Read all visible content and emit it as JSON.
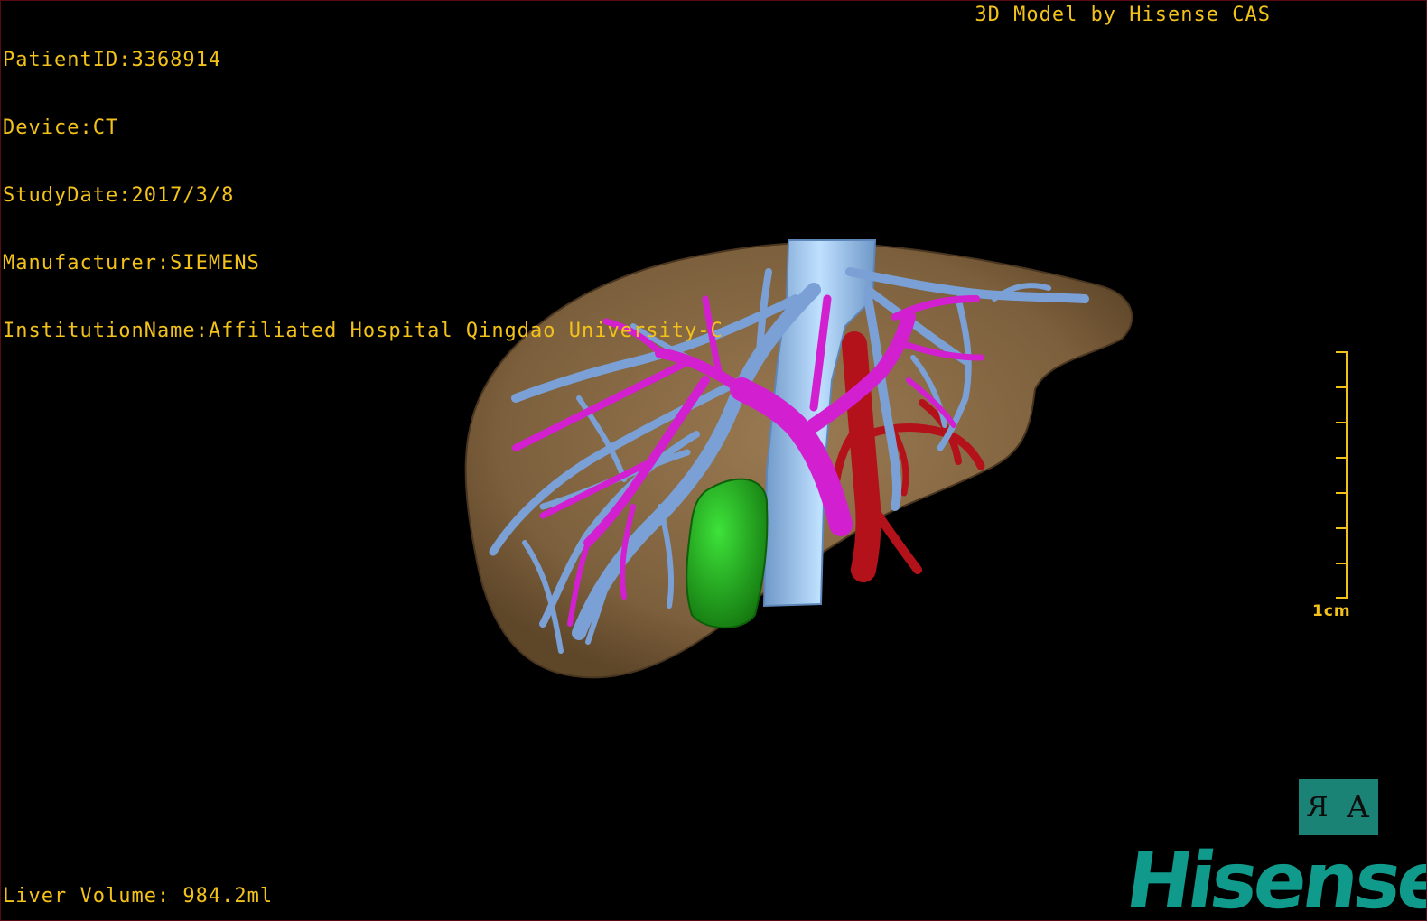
{
  "info": {
    "patient_id": "PatientID:3368914",
    "device": "Device:CT",
    "study_date": "StudyDate:2017/3/8",
    "manufacturer": "Manufacturer:SIEMENS",
    "institution": "InstitutionName:Affiliated Hospital Qingdao University-C"
  },
  "vendor_label": "3D Model by Hisense CAS",
  "liver_volume": "Liver Volume: 984.2ml",
  "scale": {
    "label": "1cm",
    "tick_count": 8
  },
  "orientation": {
    "left_glyph": "R",
    "right_glyph": "A"
  },
  "brand": "Hisense",
  "colors": {
    "overlay_text": "#f2c21b",
    "liver": "#8a6a44",
    "hepatic_vein": "#7aa0d6",
    "portal_vein": "#d21fd0",
    "artery": "#b4121a",
    "ivc": "#9ec8f0",
    "lesion": "#22b81c",
    "widget": "#1b8276",
    "brand": "#0f9a8b"
  },
  "icons": [
    "mirrored-r-icon",
    "letter-a-icon"
  ]
}
